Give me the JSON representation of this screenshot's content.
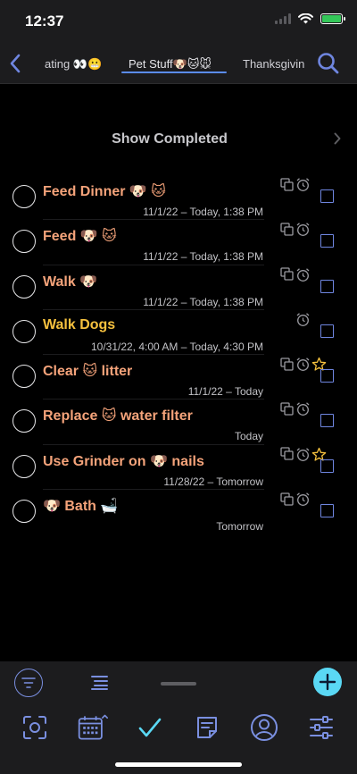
{
  "status": {
    "time": "12:37"
  },
  "nav": {
    "tabs": [
      {
        "label": "ating 👀😬"
      },
      {
        "label": "Pet Stuff🐶🐱🐭",
        "active": true
      },
      {
        "label": "Thanksgivin"
      }
    ]
  },
  "show_completed_label": "Show Completed",
  "tasks": [
    {
      "title": "Feed Dinner 🐶 🐱",
      "date": "11/1/22 – Today, 1:38 PM"
    },
    {
      "title": "Feed 🐶 🐱",
      "date": "11/1/22 – Today, 1:38 PM"
    },
    {
      "title": "Walk 🐶",
      "date": "11/1/22 – Today, 1:38 PM"
    },
    {
      "title": "Walk Dogs",
      "date": "10/31/22, 4:00 AM – Today, 4:30 PM"
    },
    {
      "title": "Clear 🐱  litter",
      "date": "11/1/22 – Today"
    },
    {
      "title": "Replace 🐱 water filter",
      "date": "Today"
    },
    {
      "title": "Use Grinder on 🐶 nails",
      "date": "11/28/22 – Tomorrow"
    },
    {
      "title": "🐶 Bath 🛁",
      "date": "Tomorrow"
    }
  ],
  "colors": {
    "title_orange": "#f4a37a",
    "title_yellow": "#f6c13e",
    "accent_blue": "#6f86e0",
    "add_button": "#5ad8f4",
    "star": "#f6c13e"
  },
  "icons": [
    "back-chevron-icon",
    "search-icon",
    "chevron-right-icon",
    "copy-icon",
    "alarm-clock-icon",
    "star-icon",
    "filter-icon",
    "list-icon",
    "plus-icon",
    "focus-scan-icon",
    "calendar-icon",
    "checkmark-icon",
    "note-icon",
    "person-icon",
    "sliders-icon"
  ]
}
